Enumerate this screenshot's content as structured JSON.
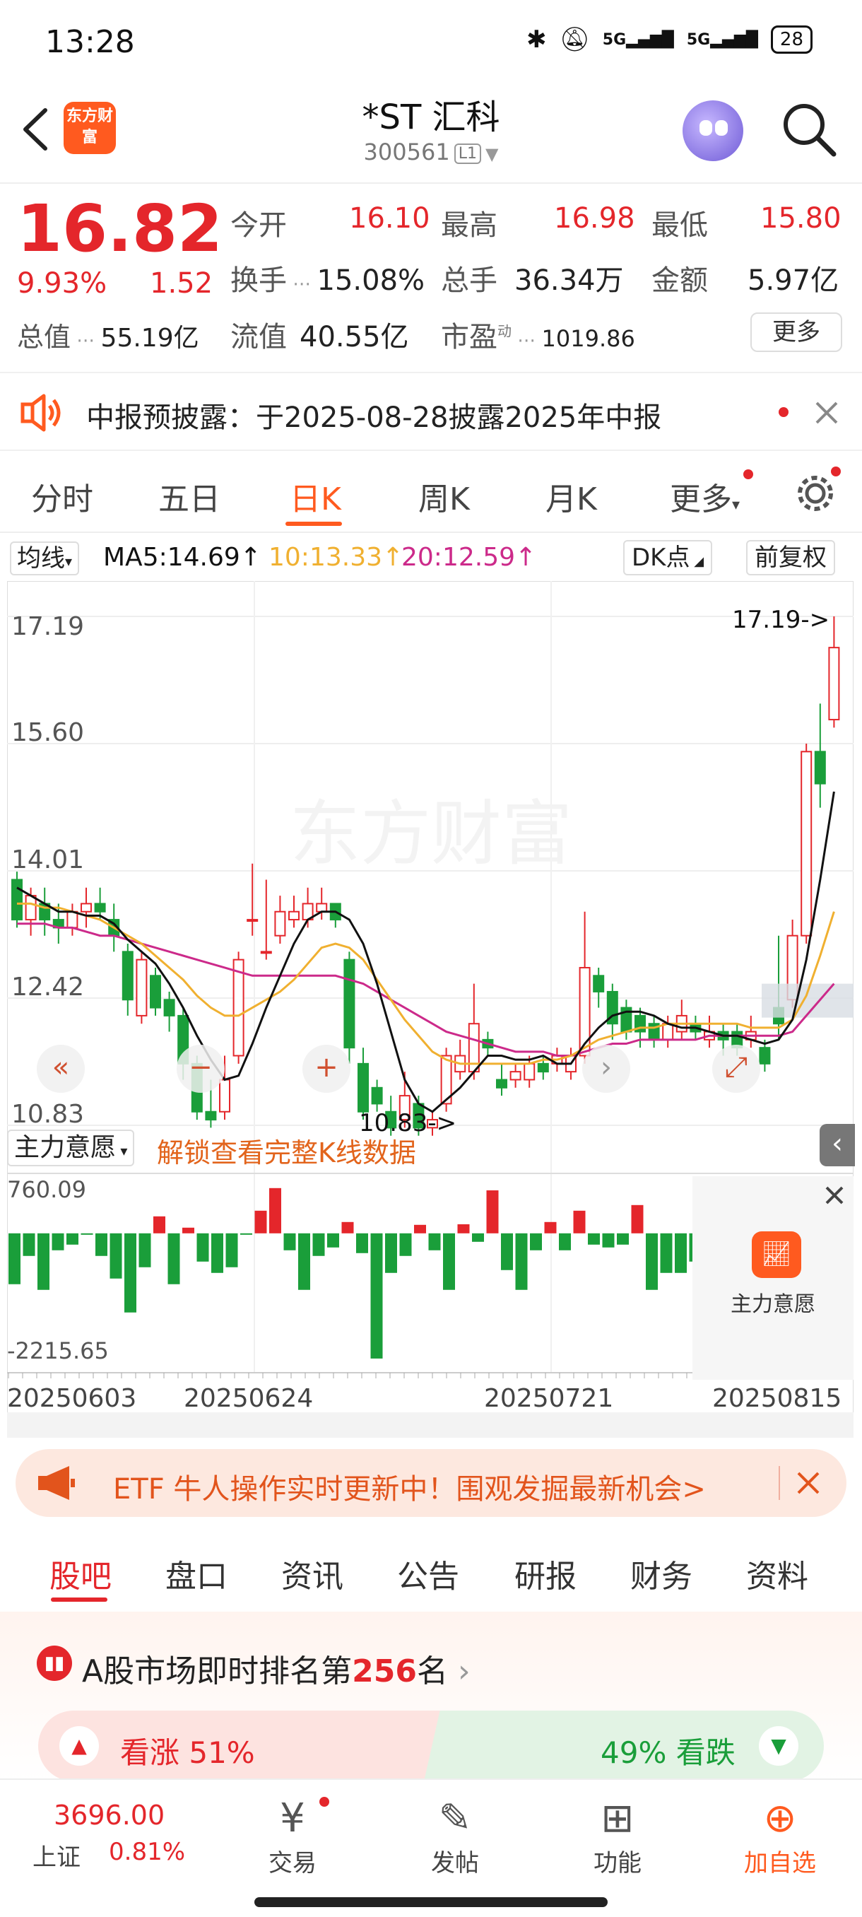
{
  "status_bar": {
    "time": "13:28",
    "net1": "5G",
    "net2": "5G",
    "battery": "28"
  },
  "header": {
    "logo_text": "东方财富",
    "title": "*ST 汇科",
    "code": "300561",
    "level": "L1"
  },
  "quote": {
    "price": "16.82",
    "change_pct": "9.93%",
    "change": "1.52",
    "open_label": "今开",
    "open": "16.10",
    "high_label": "最高",
    "high": "16.98",
    "low_label": "最低",
    "low": "15.80",
    "turnover_label": "换手",
    "turnover": "15.08%",
    "volume_label": "总手",
    "volume": "36.34万",
    "amount_label": "金额",
    "amount": "5.97亿",
    "mktcap_label": "总值",
    "mktcap": "55.19亿",
    "float_label": "流值",
    "float": "40.55亿",
    "pe_label": "市盈",
    "pe_sup": "动",
    "pe": "1019.86",
    "more": "更多"
  },
  "notice": {
    "text": "中报预披露：于2025-08-28披露2025年中报"
  },
  "period_tabs": [
    "分时",
    "五日",
    "日K",
    "周K",
    "月K",
    "更多"
  ],
  "ma_row": {
    "selector": "均线",
    "ma5": "MA5:14.69↑",
    "ma10": "10:13.33↑",
    "ma20": "20:12.59↑",
    "dk": "DK点",
    "adjust": "前复权"
  },
  "colors": {
    "up": "#e4262b",
    "down": "#1a9e3a",
    "ma5": "#111111",
    "ma10": "#f0b030",
    "ma20": "#cc2a8a",
    "accent": "#ff5a1f"
  },
  "chart_data": {
    "type": "candlestick",
    "y_ticks": [
      "17.19",
      "15.60",
      "14.01",
      "12.42",
      "10.83"
    ],
    "max_label": "17.19->",
    "min_label": "10.83->",
    "x_labels": [
      "20250603",
      "20250624",
      "20250721",
      "20250815"
    ],
    "ylim": [
      10.83,
      17.19
    ],
    "watermark": "东方财富",
    "candles": [
      [
        13.9,
        13.4,
        14.0,
        13.3
      ],
      [
        13.4,
        13.7,
        13.8,
        13.2
      ],
      [
        13.6,
        13.4,
        13.8,
        13.2
      ],
      [
        13.4,
        13.3,
        13.6,
        13.1
      ],
      [
        13.3,
        13.5,
        13.6,
        13.2
      ],
      [
        13.5,
        13.6,
        13.8,
        13.3
      ],
      [
        13.6,
        13.5,
        13.8,
        13.4
      ],
      [
        13.4,
        13.2,
        13.6,
        13.0
      ],
      [
        13.0,
        12.4,
        13.1,
        12.2
      ],
      [
        12.2,
        12.9,
        13.0,
        12.1
      ],
      [
        12.7,
        12.3,
        12.8,
        12.2
      ],
      [
        12.4,
        12.2,
        12.5,
        12.0
      ],
      [
        12.2,
        11.6,
        12.3,
        11.4
      ],
      [
        11.6,
        11.0,
        11.7,
        10.9
      ],
      [
        11.0,
        10.9,
        11.4,
        10.8
      ],
      [
        11.0,
        11.4,
        11.7,
        10.9
      ],
      [
        11.7,
        12.9,
        13.0,
        11.6
      ],
      [
        13.4,
        13.4,
        14.1,
        13.2
      ],
      [
        13.0,
        13.0,
        13.9,
        12.9
      ],
      [
        13.2,
        13.5,
        13.7,
        13.1
      ],
      [
        13.4,
        13.5,
        13.7,
        13.3
      ],
      [
        13.4,
        13.6,
        13.8,
        13.3
      ],
      [
        13.5,
        13.6,
        13.8,
        13.4
      ],
      [
        13.6,
        13.4,
        13.6,
        13.3
      ],
      [
        12.9,
        11.8,
        13.0,
        11.6
      ],
      [
        11.6,
        11.0,
        11.8,
        10.9
      ],
      [
        11.3,
        11.1,
        11.4,
        11.0
      ],
      [
        11.0,
        10.8,
        11.2,
        10.7
      ],
      [
        10.9,
        11.2,
        11.5,
        10.8
      ],
      [
        11.1,
        10.8,
        11.2,
        10.7
      ],
      [
        10.8,
        10.9,
        11.0,
        10.7
      ],
      [
        11.1,
        11.7,
        11.8,
        11.0
      ],
      [
        11.5,
        11.7,
        11.9,
        11.4
      ],
      [
        11.5,
        12.1,
        12.6,
        11.4
      ],
      [
        11.9,
        11.8,
        12.0,
        11.7
      ],
      [
        11.4,
        11.3,
        11.6,
        11.2
      ],
      [
        11.4,
        11.5,
        11.6,
        11.3
      ],
      [
        11.4,
        11.6,
        11.7,
        11.3
      ],
      [
        11.6,
        11.5,
        11.7,
        11.4
      ],
      [
        11.6,
        11.7,
        11.8,
        11.5
      ],
      [
        11.5,
        11.7,
        11.8,
        11.4
      ],
      [
        11.7,
        12.8,
        13.5,
        11.6
      ],
      [
        12.7,
        12.5,
        12.8,
        12.3
      ],
      [
        12.5,
        12.1,
        12.6,
        11.9
      ],
      [
        12.3,
        12.0,
        12.4,
        11.9
      ],
      [
        12.2,
        12.0,
        12.3,
        11.8
      ],
      [
        12.1,
        11.9,
        12.2,
        11.8
      ],
      [
        11.9,
        12.1,
        12.2,
        11.8
      ],
      [
        12.0,
        12.2,
        12.4,
        11.9
      ],
      [
        12.1,
        12.0,
        12.2,
        11.9
      ],
      [
        11.9,
        12.0,
        12.2,
        11.8
      ],
      [
        12.0,
        11.9,
        12.1,
        11.7
      ],
      [
        12.0,
        11.8,
        12.1,
        11.7
      ],
      [
        11.9,
        12.0,
        12.2,
        11.8
      ],
      [
        11.8,
        11.6,
        11.9,
        11.5
      ],
      [
        12.3,
        12.1,
        13.2,
        11.9
      ],
      [
        12.4,
        13.2,
        13.4,
        12.3
      ],
      [
        13.2,
        15.5,
        15.6,
        13.1
      ],
      [
        15.5,
        15.1,
        16.1,
        14.8
      ],
      [
        15.9,
        16.8,
        17.19,
        15.8
      ]
    ],
    "ma5": [
      13.8,
      13.7,
      13.6,
      13.5,
      13.5,
      13.45,
      13.45,
      13.35,
      13.15,
      13.0,
      12.85,
      12.6,
      12.3,
      11.95,
      11.65,
      11.4,
      11.45,
      11.85,
      12.3,
      12.7,
      13.1,
      13.4,
      13.5,
      13.5,
      13.4,
      13.1,
      12.6,
      12.0,
      11.4,
      11.1,
      11.0,
      11.15,
      11.3,
      11.5,
      11.7,
      11.7,
      11.65,
      11.65,
      11.7,
      11.6,
      11.6,
      11.85,
      12.05,
      12.2,
      12.25,
      12.25,
      12.2,
      12.1,
      12.05,
      12.05,
      12.0,
      11.95,
      11.95,
      11.9,
      11.85,
      11.9,
      12.15,
      12.9,
      13.9,
      15.0
    ],
    "ma10": [
      13.6,
      13.6,
      13.55,
      13.55,
      13.5,
      13.45,
      13.4,
      13.3,
      13.2,
      13.1,
      12.95,
      12.8,
      12.65,
      12.45,
      12.3,
      12.2,
      12.2,
      12.3,
      12.4,
      12.5,
      12.65,
      12.85,
      13.05,
      13.1,
      13.05,
      12.9,
      12.65,
      12.4,
      12.15,
      11.95,
      11.75,
      11.65,
      11.6,
      11.6,
      11.6,
      11.6,
      11.6,
      11.6,
      11.65,
      11.65,
      11.7,
      11.8,
      11.9,
      11.95,
      12.0,
      12.05,
      12.05,
      12.1,
      12.1,
      12.1,
      12.1,
      12.1,
      12.1,
      12.05,
      12.05,
      12.05,
      12.15,
      12.45,
      12.95,
      13.5
    ],
    "ma20": [
      13.35,
      13.35,
      13.35,
      13.3,
      13.3,
      13.25,
      13.2,
      13.2,
      13.15,
      13.1,
      13.05,
      13.0,
      12.95,
      12.9,
      12.85,
      12.8,
      12.75,
      12.7,
      12.7,
      12.7,
      12.7,
      12.7,
      12.7,
      12.7,
      12.65,
      12.6,
      12.5,
      12.4,
      12.3,
      12.2,
      12.1,
      12.0,
      11.95,
      11.9,
      11.85,
      11.8,
      11.75,
      11.75,
      11.75,
      11.7,
      11.7,
      11.75,
      11.8,
      11.85,
      11.85,
      11.9,
      11.9,
      11.9,
      11.9,
      11.9,
      11.95,
      11.95,
      11.95,
      11.95,
      11.95,
      11.95,
      12.0,
      12.2,
      12.4,
      12.6
    ]
  },
  "indicator": {
    "selector": "主力意愿",
    "unlock": "解锁查看完整K线数据",
    "max": "760.09",
    "min": "-2215.65",
    "panel_label": "主力意愿",
    "bars": [
      -900,
      -400,
      -1000,
      -300,
      -200,
      0,
      -400,
      -800,
      -1400,
      -600,
      300,
      -900,
      100,
      -500,
      -700,
      -600,
      0,
      400,
      800,
      -300,
      -1000,
      -400,
      -250,
      200,
      -350,
      -2215,
      -700,
      -400,
      150,
      -300,
      -1000,
      160,
      -150,
      760,
      -650,
      -1000,
      -300,
      200,
      -300,
      400,
      -200,
      -250,
      -200,
      500,
      -1000,
      -700,
      -700,
      -500
    ]
  },
  "etf_banner": {
    "text": "ETF 牛人操作实时更新中！围观发掘最新机会>"
  },
  "content_tabs": [
    "股吧",
    "盘口",
    "资讯",
    "公告",
    "研报",
    "财务",
    "资料"
  ],
  "rank": {
    "prefix": "A股市场即时排名第",
    "number": "256",
    "suffix": "名"
  },
  "vote": {
    "up": "看涨 51%",
    "down": "49% 看跌"
  },
  "bottom_nav": {
    "index_value": "3696.00",
    "index_name": "上证",
    "index_change": "0.81%",
    "trade": "交易",
    "post": "发帖",
    "func": "功能",
    "watch": "加自选"
  }
}
